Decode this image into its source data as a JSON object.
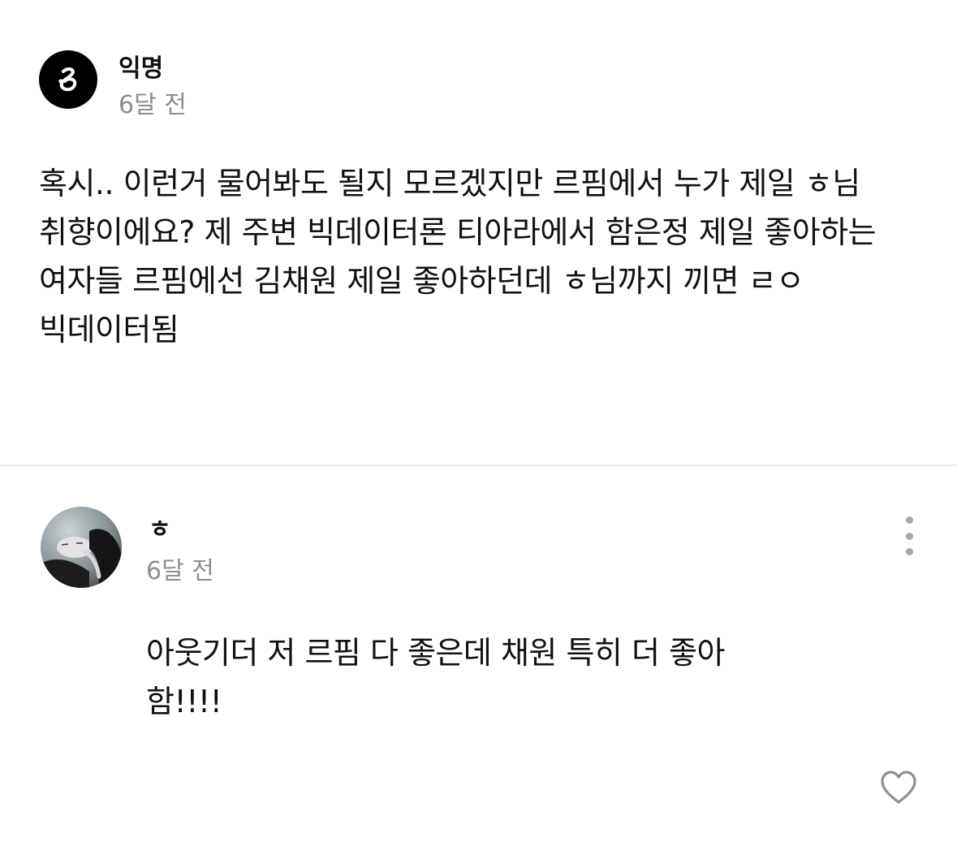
{
  "post": {
    "author": "익명",
    "time": "6달 전",
    "body": "혹시.. 이런거 물어봐도 될지 모르겠지만 르핌에서 누가 제일 ㅎ님 취향이에요? 제 주변 빅데이터론 티아라에서 함은정 제일 좋아하는 여자들 르핌에선 김채원 제일 좋아하던데 ㅎ님까지 끼면 ㄹㅇ 빅데이터됨"
  },
  "comment": {
    "author": "ㅎ",
    "time": "6달 전",
    "body": "아웃기더 저 르핌 다 좋은데 채원 특히 더 좋아함!!!!"
  },
  "icons": {
    "anon_avatar": "anonymous-logo-icon",
    "more": "more-vertical-icon",
    "like": "heart-outline-icon"
  },
  "colors": {
    "text": "#111111",
    "muted": "#8e8e8e",
    "divider": "#e9e9e9",
    "icon": "#a9a9a9"
  }
}
